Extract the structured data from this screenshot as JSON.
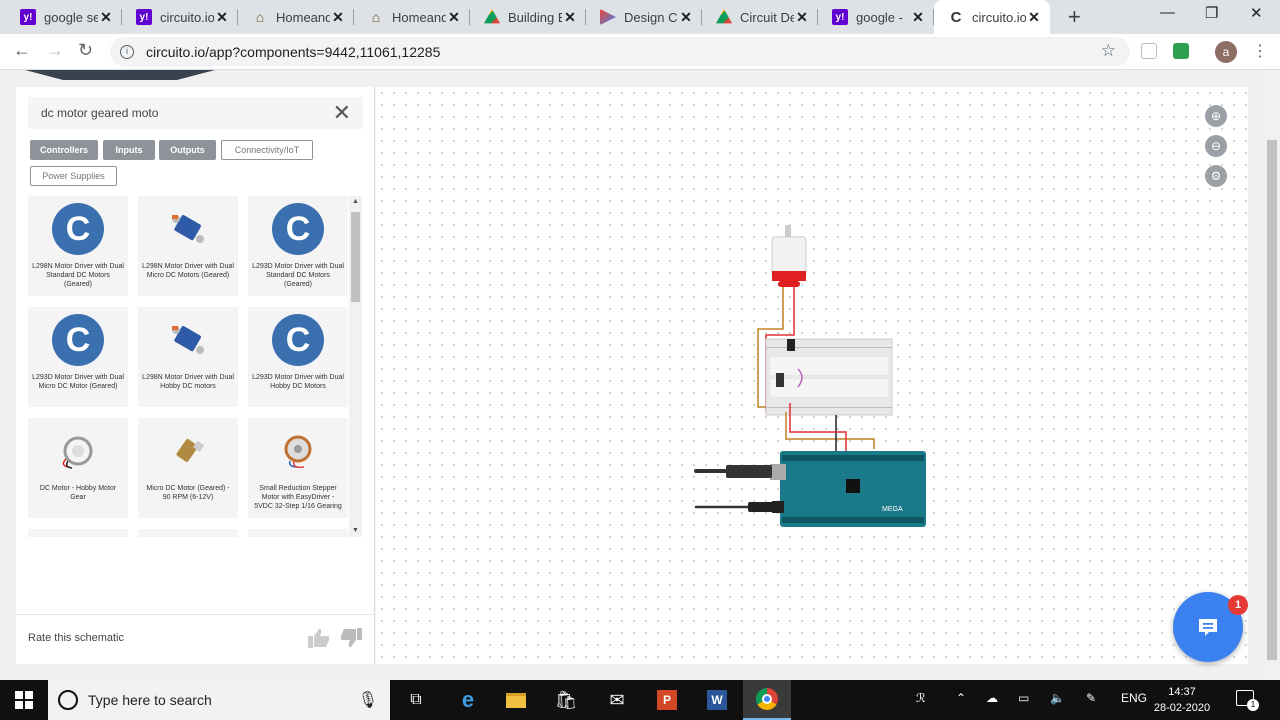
{
  "browser": {
    "tabs": [
      {
        "title": "google se",
        "icon": "yahoo-icon"
      },
      {
        "title": "circuito.io",
        "icon": "yahoo-icon"
      },
      {
        "title": "Homeand",
        "icon": "homeandlearn-icon"
      },
      {
        "title": "Homeand",
        "icon": "homeandlearn-icon"
      },
      {
        "title": "Building E",
        "icon": "google-drive-icon"
      },
      {
        "title": "Design Ci",
        "icon": "design-icon"
      },
      {
        "title": "Circuit De",
        "icon": "google-drive-icon"
      },
      {
        "title": "google -",
        "icon": "yahoo-icon"
      },
      {
        "title": "circuito.io",
        "icon": "circuito-icon",
        "active": true
      }
    ],
    "url": "circuito.io/app?components=9442,11061,12285",
    "profile_initial": "a"
  },
  "sidebar": {
    "search_value": "dc motor geared moto",
    "filters": [
      "Controllers",
      "Inputs",
      "Outputs",
      "Connectivity/IoT",
      "Power Supplies"
    ],
    "components": [
      {
        "label": "L298N Motor Driver with Dual Standard DC Motors (Geared)",
        "thumb": "circuito-logo"
      },
      {
        "label": "L298N Motor Driver with Dual Micro DC Motors (Geared)",
        "thumb": "board"
      },
      {
        "label": "L293D Motor Driver with Dual Standard DC Motors (Geared)",
        "thumb": "circuito-logo"
      },
      {
        "label": "L293D Motor Driver with Dual Micro DC Motor (Geared)",
        "thumb": "circuito-logo"
      },
      {
        "label": "L298N Motor Driver with Dual Hobby DC motors",
        "thumb": "board"
      },
      {
        "label": "L293D Motor Driver with Dual Hobby DC Motors",
        "thumb": "circuito-logo"
      },
      {
        "label": "DC Motor - Hobby Motor Gear",
        "thumb": "motor"
      },
      {
        "label": "Micro DC Motor (Geared) - 90 RPM (6-12V)",
        "thumb": "micro-motor"
      },
      {
        "label": "Small Reduction Stepper Motor with EasyDriver - 5VDC 32-Step 1/16 Gearing",
        "thumb": "stepper"
      }
    ],
    "rate_label": "Rate this schematic"
  },
  "canvas": {
    "board_label": "MEGA",
    "chat_badge": "1"
  },
  "taskbar": {
    "search_placeholder": "Type here to search",
    "lang": "ENG",
    "time": "14:37",
    "date": "28-02-2020",
    "notifications": "1"
  }
}
